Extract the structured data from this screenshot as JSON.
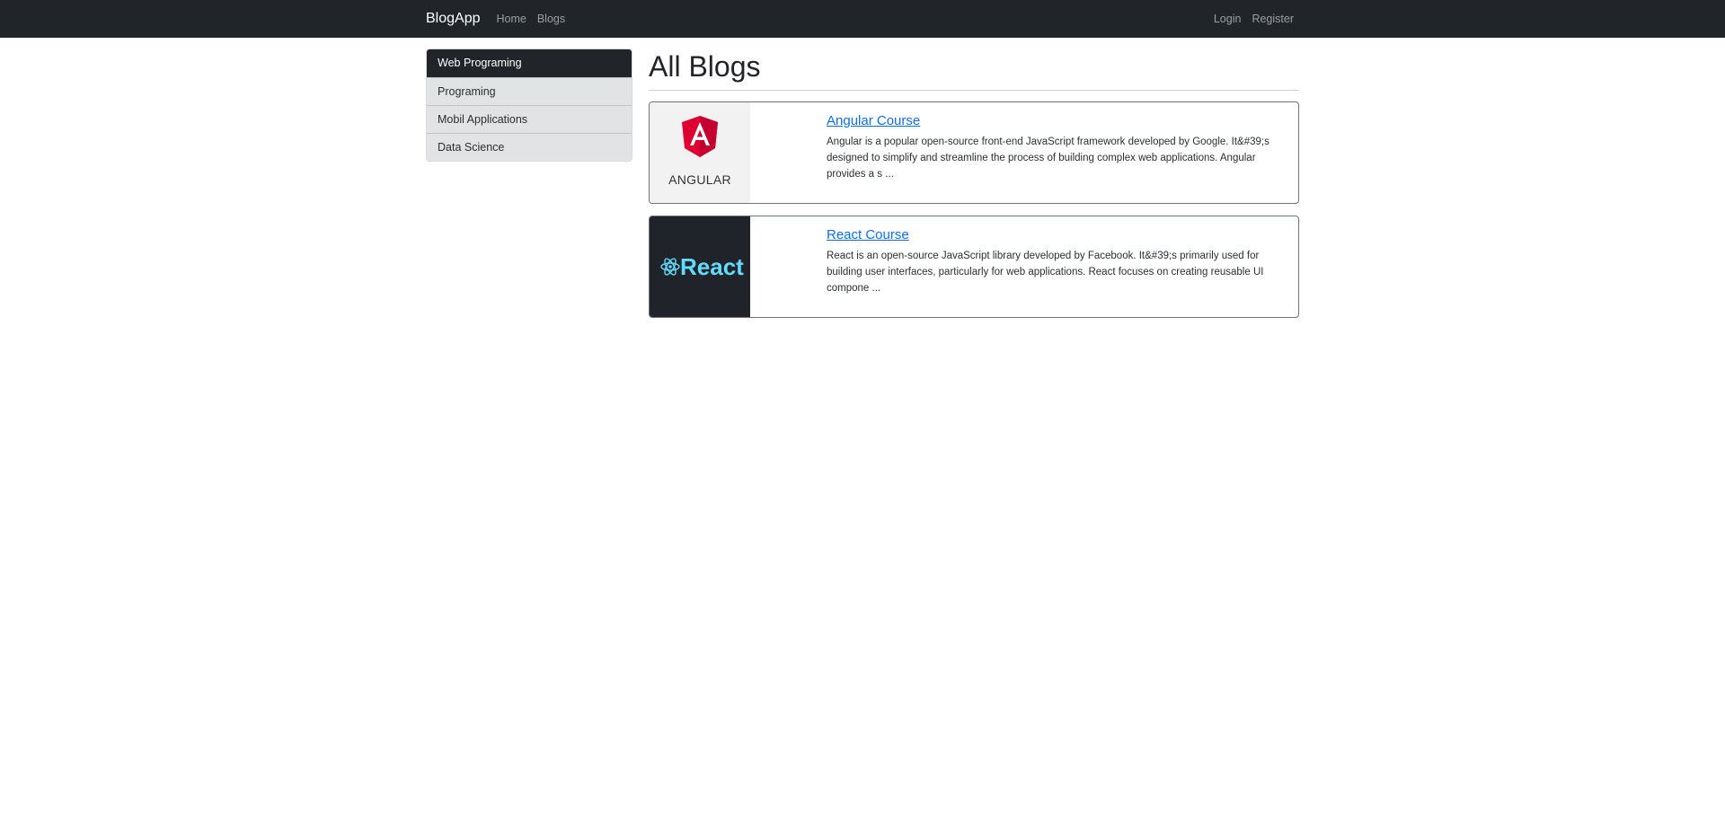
{
  "navbar": {
    "brand": "BlogApp",
    "links": [
      "Home",
      "Blogs"
    ],
    "right_links": [
      "Login",
      "Register"
    ]
  },
  "sidebar": {
    "items": [
      {
        "label": "Web Programing",
        "active": true
      },
      {
        "label": "Programing",
        "active": false
      },
      {
        "label": "Mobil Applications",
        "active": false
      },
      {
        "label": "Data Science",
        "active": false
      }
    ]
  },
  "main": {
    "title": "All Blogs",
    "blogs": [
      {
        "title": "Angular Course",
        "excerpt": "Angular is a popular open-source front-end JavaScript framework developed by Google. It&#39;s designed to simplify and streamline the process of building complex web applications. Angular provides a s ...",
        "image_logo": "angular-logo",
        "image_text": "ANGULAR"
      },
      {
        "title": "React Course",
        "excerpt": "React is an open-source JavaScript library developed by Facebook. It&#39;s primarily used for building user interfaces, particularly for web applications. React focuses on creating reusable UI compone ...",
        "image_logo": "react-logo",
        "image_text": "React"
      }
    ]
  },
  "colors": {
    "navbar_bg": "#212529",
    "active_item_bg": "#212529",
    "list_item_bg": "#e2e3e5",
    "link_blue": "#0d6efd",
    "angular_red": "#dd0031",
    "react_cyan": "#61dafb"
  }
}
